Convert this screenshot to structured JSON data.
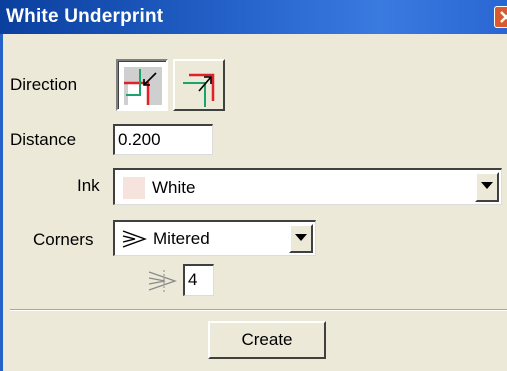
{
  "window": {
    "title": "White Underprint",
    "close_icon": "close-icon"
  },
  "direction": {
    "label": "Direction",
    "options": [
      {
        "icon": "inward-arrow-icon",
        "selected": true
      },
      {
        "icon": "outward-arrow-icon",
        "selected": false
      }
    ]
  },
  "distance": {
    "label": "Distance",
    "value": "0.200"
  },
  "ink": {
    "label": "Ink",
    "value": "White",
    "swatch_color": "#f6e3de"
  },
  "corners": {
    "label": "Corners",
    "value": "Mitered",
    "icon": "mitered-corner-icon"
  },
  "miter_limit": {
    "icon": "miter-limit-icon",
    "value": "4"
  },
  "actions": {
    "create_label": "Create"
  },
  "colors": {
    "title_bar": "#2461c8",
    "accent_red": "#e0202a",
    "accent_green": "#1aa36a"
  }
}
